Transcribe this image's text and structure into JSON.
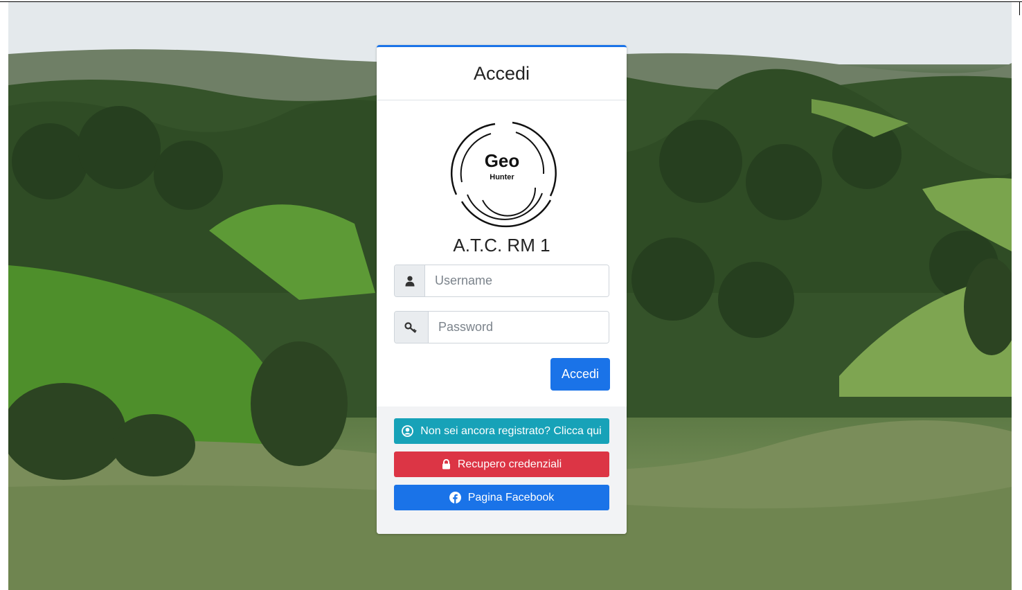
{
  "login": {
    "header_title": "Accedi",
    "logo": {
      "main": "Geo",
      "sub": "Hunter"
    },
    "app_name": "A.T.C. RM 1",
    "username": {
      "placeholder": "Username",
      "value": ""
    },
    "password": {
      "placeholder": "Password",
      "value": ""
    },
    "submit_label": "Accedi"
  },
  "footer": {
    "register_label": "Non sei ancora registrato? Clicca qui",
    "recover_label": "Recupero credenziali",
    "facebook_label": "Pagina Facebook"
  },
  "icons": {
    "username": "user-icon",
    "password": "key-icon",
    "register": "user-circle-icon",
    "recover": "lock-icon",
    "facebook": "facebook-icon"
  },
  "colors": {
    "primary": "#1a73e8",
    "info": "#17a2b8",
    "danger": "#dc3545",
    "card_footer": "#f2f3f5"
  }
}
